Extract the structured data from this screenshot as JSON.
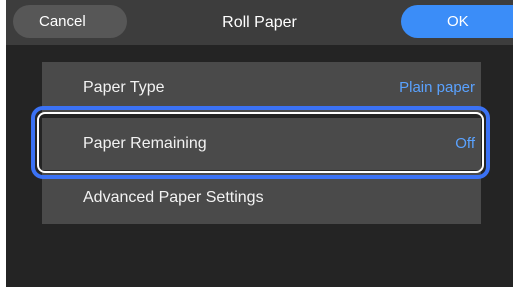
{
  "header": {
    "cancel_label": "Cancel",
    "title": "Roll Paper",
    "ok_label": "OK"
  },
  "menu": {
    "items": [
      {
        "label": "Paper Type",
        "value": "Plain paper"
      },
      {
        "label": "Paper Remaining",
        "value": "Off",
        "focused": true
      },
      {
        "label": "Advanced Paper Settings",
        "value": ""
      }
    ]
  },
  "colors": {
    "screen_background": "#242424",
    "header_background": "#3d3d3d",
    "row_background": "#4a4a4a",
    "accent": "#3b8df8",
    "value_text": "#5aa2ff",
    "focus_ring": "#3b72f5"
  }
}
